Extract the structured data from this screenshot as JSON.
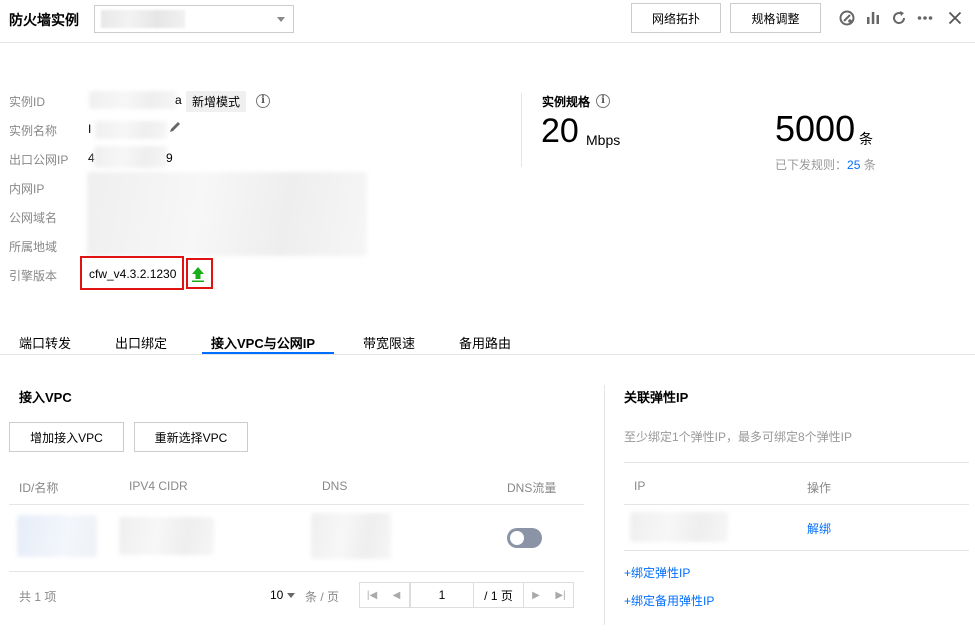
{
  "header": {
    "title": "防火墙实例",
    "btn_topology": "网络拓扑",
    "btn_spec": "规格调整",
    "icons": [
      "monitor-icon",
      "bar-chart-icon",
      "refresh-icon",
      "more-icon",
      "close-icon"
    ]
  },
  "info": {
    "labels": {
      "id": "实例ID",
      "name": "实例名称",
      "egress_ip": "出口公网IP",
      "private_ip": "内网IP",
      "domain": "公网域名",
      "region": "所属地域",
      "engine": "引擎版本"
    },
    "id_suffix": "a",
    "mode_badge": "新增模式",
    "name_prefix": "I",
    "ip_first": "4",
    "ip_last": "9",
    "engine_version": "cfw_v4.3.2.1230"
  },
  "spec": {
    "label": "实例规格",
    "bandwidth_value": "20",
    "bandwidth_unit": "Mbps",
    "rule_value": "5000",
    "rule_unit": "条",
    "issued_prefix": "已下发规则：",
    "issued_count": "25",
    "issued_unit": " 条"
  },
  "tabs": [
    "端口转发",
    "出口绑定",
    "接入VPC与公网IP",
    "带宽限速",
    "备用路由"
  ],
  "active_tab_index": 2,
  "vpc": {
    "title": "接入VPC",
    "btn_add": "增加接入VPC",
    "btn_reselect": "重新选择VPC",
    "columns": [
      "ID/名称",
      "IPV4 CIDR",
      "DNS",
      "DNS流量"
    ],
    "dns_toggle_on": false,
    "total": "共 1 项",
    "page_size": "10",
    "page_size_unit": "条 / 页",
    "current_page": "1",
    "total_pages": "/ 1 页"
  },
  "eip": {
    "title": "关联弹性IP",
    "hint": "至少绑定1个弹性IP，最多可绑定8个弹性IP",
    "columns": [
      "IP",
      "操作"
    ],
    "unbind": "解绑",
    "bind_eip": "+绑定弹性IP",
    "bind_backup_eip": "+绑定备用弹性IP"
  },
  "colors": {
    "accent": "#006eff",
    "highlight_red": "#e01212",
    "upgrade_green": "#1aac19"
  }
}
